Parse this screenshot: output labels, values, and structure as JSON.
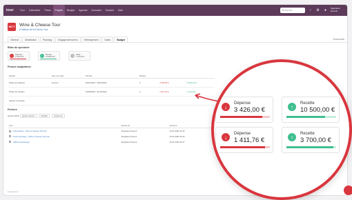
{
  "topbar": {
    "logo": "tour",
    "nav": [
      "Tour",
      "Calendrier",
      "Plans",
      "Projets",
      "Budget",
      "Agenda",
      "Annuaire",
      "Dossier",
      "Aide"
    ],
    "active_index": 3,
    "search_placeholder": "Recherche",
    "user_name": "Stephanie Pouvoir"
  },
  "project": {
    "badge": "WCT",
    "title": "Wine & Cheese Tour",
    "subtitle": "(Château de la Roche) Tour"
  },
  "tabs": {
    "items": [
      "Général",
      "Distribution",
      "Planning",
      "Engagement prévu",
      "Hébergement",
      "Dates",
      "Budget"
    ],
    "active_index": 6,
    "right_label": "Documents"
  },
  "sections": {
    "summary": "Bilan du spectacle",
    "phases": "Phases budgétaires",
    "documents": "Fichiers"
  },
  "summary_cards": [
    {
      "label": "Dépense",
      "value": "3 426,00 €",
      "kind": "expense"
    },
    {
      "label": "Recette",
      "value": "10 500,00 €",
      "kind": "income"
    },
    {
      "label": "Solde",
      "value": "7 074,00 €",
      "kind": "balance"
    }
  ],
  "phase_table": {
    "headers": [
      "Modèle",
      "Type de projet",
      "Période",
      "Budget"
    ],
    "rows": [
      {
        "name": "Phase de réflexion",
        "type": "Concert",
        "period": "20/01/2023 - 30/04/2023",
        "count": "2",
        "expense": "3 426,00 €",
        "income": "10 500,00 €"
      },
      {
        "name": "Phase de création",
        "type": "",
        "period": "01/05/2023 - 31/12/2023",
        "count": "2",
        "expense": "1 411,76 €",
        "income": "3 700,00 €"
      }
    ],
    "add_link": "Ajouter une phase"
  },
  "documents": {
    "toolbar_label": "Ajouter fichier",
    "buttons": [
      "Ajouter dossier",
      "Modifier",
      "Supprimer"
    ],
    "headers": [
      "Nom",
      "Ajouté par",
      "Ajouté le"
    ],
    "rows": [
      {
        "name": "Présentation - Wine & Cheese Tour.pdf",
        "by": "Stephanie Pouvoir",
        "date": "01.01.2023 16:15"
      },
      {
        "name": "Fiche technique - Wine & Cheese Tour.pdf",
        "by": "Stephanie Pouvoir",
        "date": "01.01.2023 16:16"
      },
      {
        "name": "Affiche Festival.jpg",
        "by": "Stephanie Pouvoir",
        "date": "01.01.2023 16:17"
      }
    ]
  },
  "footer": "Powered by ©",
  "zoom": {
    "cards": [
      {
        "label": "Dépense",
        "value": "3 426,00 €",
        "kind": "expense",
        "progress": 0.85
      },
      {
        "label": "Recette",
        "value": "10 500,00 €",
        "kind": "income",
        "progress": 0.78
      },
      {
        "label": "Dépense",
        "value": "1 411,76 €",
        "kind": "expense",
        "progress": 0.9
      },
      {
        "label": "Recette",
        "value": "3 700,00 €",
        "kind": "income",
        "progress": 0.95
      }
    ]
  },
  "colors": {
    "brand": "#5d3a5a",
    "expense": "#d9363e",
    "income": "#3fbf8f",
    "link": "#3a7bbf"
  }
}
